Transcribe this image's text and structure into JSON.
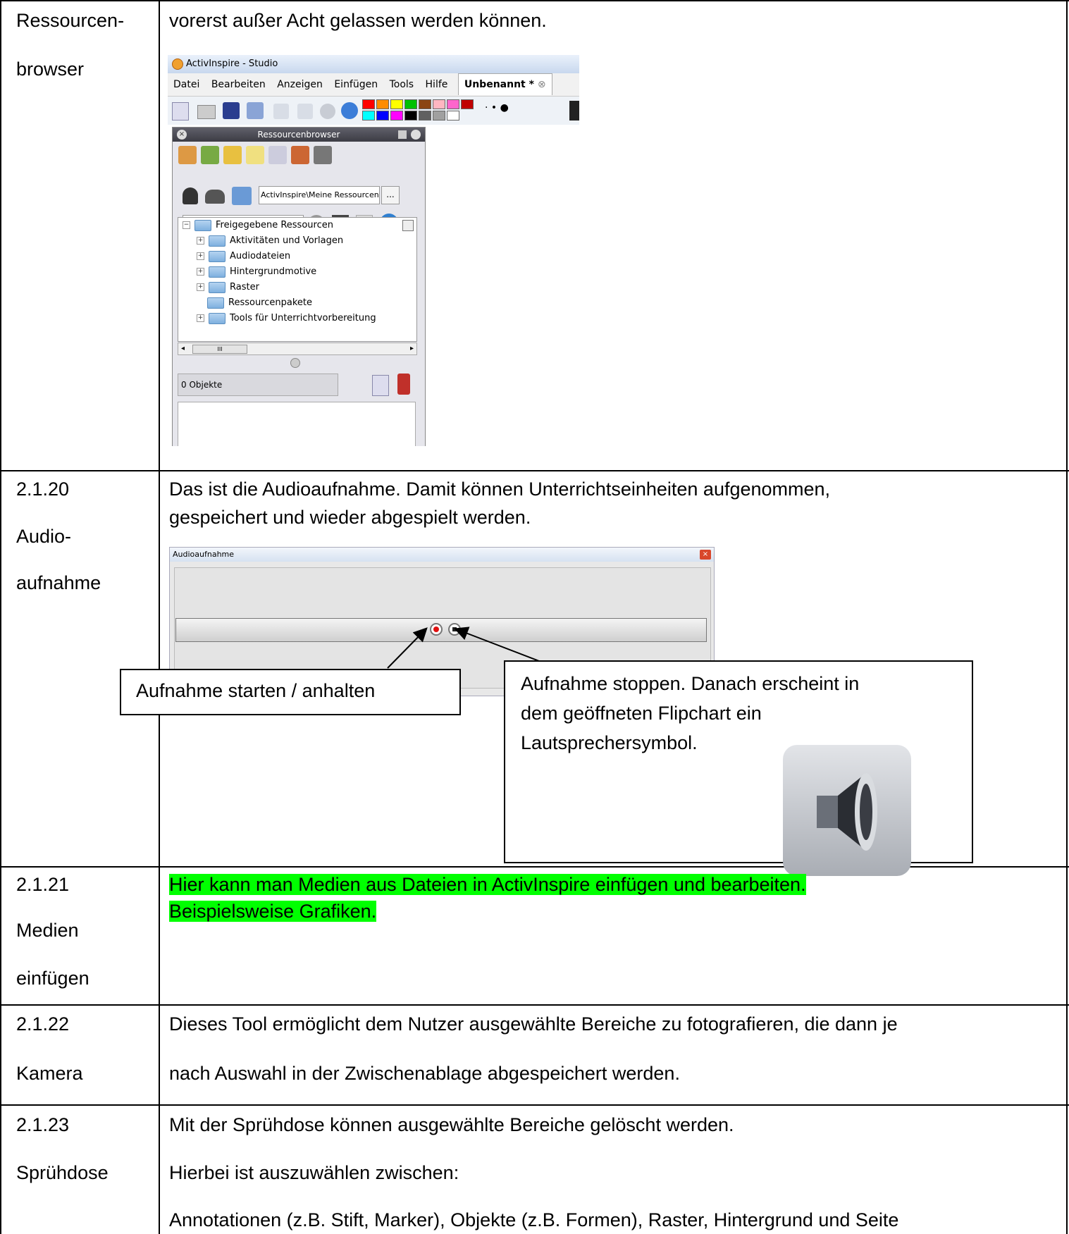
{
  "rows": [
    {
      "label_lines": [
        "Ressourcen-",
        "browser"
      ],
      "text_lines": [
        "vorerst außer Acht gelassen werden können."
      ]
    },
    {
      "label_lines": [
        "2.1.20",
        "Audio-",
        "aufnahme"
      ],
      "text_lines": [
        "Das ist die Audioaufnahme. Damit können Unterrichtseinheiten aufgenommen,",
        "gespeichert und wieder abgespielt werden."
      ]
    },
    {
      "label_lines": [
        "2.1.21",
        "Medien",
        "einfügen"
      ],
      "text_lines": [
        "Hier kann man Medien aus Dateien in ActivInspire einfügen und bearbeiten.",
        "Beispielsweise Grafiken."
      ],
      "highlight": "#00ff00"
    },
    {
      "label_lines": [
        "2.1.22",
        "Kamera"
      ],
      "text_lines": [
        "Dieses Tool ermöglicht dem Nutzer ausgewählte Bereiche zu fotografieren, die dann je",
        "nach Auswahl in der Zwischenablage abgespeichert werden."
      ]
    },
    {
      "label_lines": [
        "2.1.23",
        "Sprühdose"
      ],
      "text_lines": [
        "Mit der Sprühdose können ausgewählte Bereiche gelöscht werden.",
        "Hierbei ist auszuwählen zwischen:",
        "Annotationen (z.B. Stift, Marker), Objekte (z.B. Formen), Raster, Hintergrund und Seite"
      ]
    }
  ],
  "activinspire": {
    "window_title": "ActivInspire - Studio",
    "menu": [
      "Datei",
      "Bearbeiten",
      "Anzeigen",
      "Einfügen",
      "Tools",
      "Hilfe"
    ],
    "doc_tab": "Unbenannt *",
    "panel_title": "Ressourcenbrowser",
    "path": "ActivInspire\\Meine Ressourcen",
    "path_button": "...",
    "tree": {
      "root": "Freigegebene Ressourcen",
      "items": [
        "Aktivitäten und Vorlagen",
        "Audiodateien",
        "Hintergrundmotive",
        "Raster",
        "Ressourcenpakete",
        "Tools für Unterrichtvorbereitung"
      ]
    },
    "scroll_glyph": "III",
    "objects_count": "0 Objekte",
    "palette": [
      "#ff0000",
      "#ff8c00",
      "#ffff00",
      "#00c000",
      "#8b4513",
      "#ffb6c1",
      "#ff66cc",
      "#c00000",
      "#00ffff",
      "#0000ff",
      "#ff00ff",
      "#000000",
      "#606060",
      "#a0a0a0",
      "#ffffff"
    ]
  },
  "audio_window": {
    "title": "Audioaufnahme",
    "callout_record": "Aufnahme starten / anhalten",
    "callout_stop_lines": [
      "Aufnahme stoppen. Danach erscheint in",
      "dem geöffneten Flipchart ein",
      "Lautsprechersymbol."
    ]
  }
}
